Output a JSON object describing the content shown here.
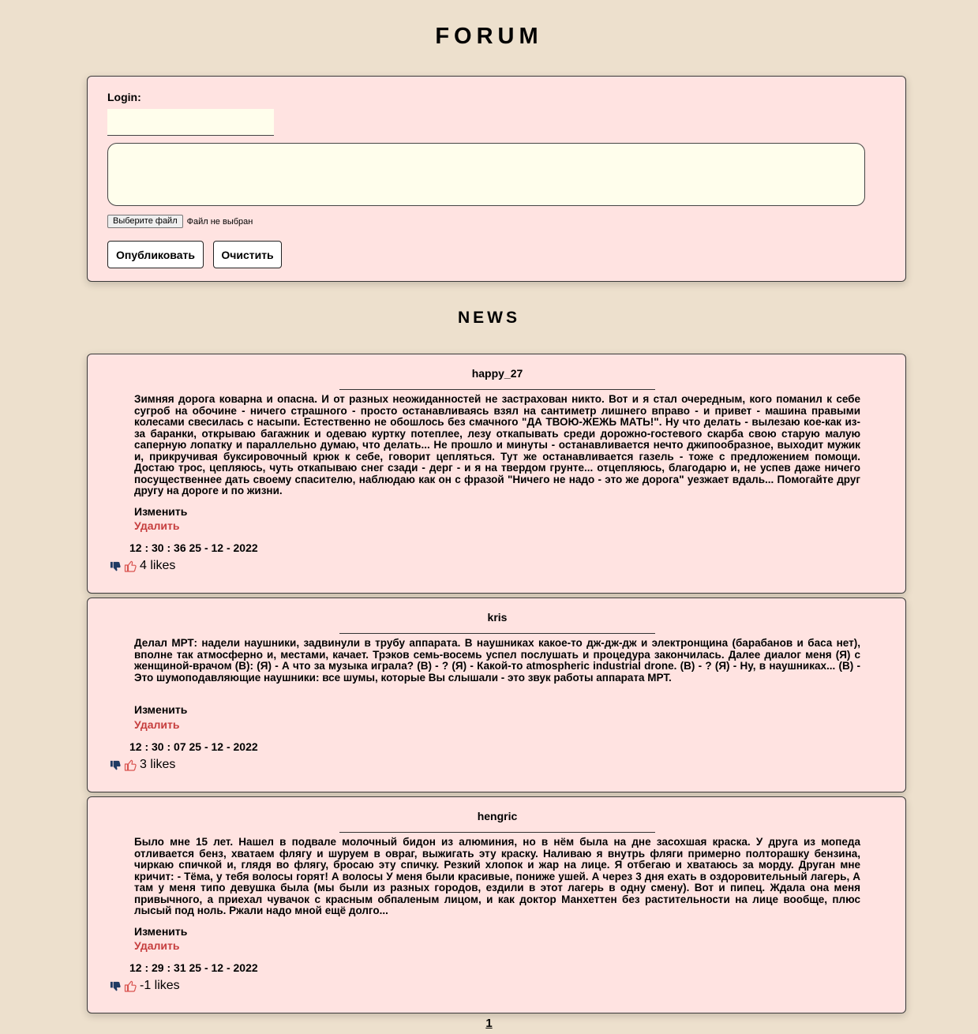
{
  "header": {
    "title": "FORUM"
  },
  "form": {
    "login_label": "Login:",
    "login_value": "",
    "message_value": "",
    "file_button_label": "Выберите файл",
    "file_status": "Файл не выбран",
    "publish_label": "Опубликовать",
    "clear_label": "Очистить"
  },
  "news": {
    "title": "NEWS",
    "edit_label": "Изменить",
    "delete_label": "Удалить",
    "posts": [
      {
        "author": "happy_27",
        "text": "Зимняя дорога коварна и опасна. И от разных неожиданностей не застрахован никто. Вот и я стал очередным, кого поманил к себе сугроб на обочине - ничего страшного - просто останавливаясь взял на сантиметр лишнего вправо - и привет - машина правыми колесами свесилась с насыпи. Естественно не обошлось без смачного \"ДА ТВОЮ-ЖЕЖЬ МАТЬ!\". Ну что делать - вылезаю кое-как из-за баранки, открываю багажник и одеваю куртку потеплее, лезу откапывать среди дорожно-гостевого скарба свою старую малую саперную лопатку и параллельно думаю, что делать... Не прошло и минуты - останавливается нечто джипообразное, выходит мужик и, прикручивая буксировочный крюк к себе, говорит цепляться. Тут же останавливается газель - тоже с предложением помощи. Достаю трос, цепляюсь, чуть откапываю снег сзади - дерг - и я на твердом грунте... отцепляюсь, благодарю и, не успев даже ничего посущественнее дать своему спасителю, наблюдаю как он с фразой \"Ничего не надо - это же дорога\" уезжает вдаль... Помогайте друг другу на дороге и по жизни.",
        "time": "12 : 30 : 36 25 - 12 - 2022",
        "likes": "4 likes"
      },
      {
        "author": "kris",
        "text": "Делал МРТ: надели наушники, задвинули в трубу аппарата. В наушниках какое-то дж-дж-дж и электронщина (барабанов и баса нет), вполне так атмосферно и, местами, качает. Трэков семь-восемь успел послушать и процедура закончилась. Далее диалог меня (Я) с женщиной-врачом (В): (Я) - А что за музыка играла? (В) - ? (Я) - Какой-то atmospheric industrial drone. (В) - ? (Я) - Ну, в наушниках... (В) - Это шумоподавляющие наушники: все шумы, которые Вы слышали - это звук работы аппарата МРТ.",
        "time": "12 : 30 : 07 25 - 12 - 2022",
        "likes": "3 likes"
      },
      {
        "author": "hengric",
        "text": "Было мне 15 лет. Нашел в подвале молочный бидон из алюминия, но в нём была на дне засохшая краска. У друга из мопеда отливается бенз, хватаем флягу и шуруем в овраг, выжигать эту краску. Наливаю я внутрь фляги примерно полторашку бензина, чиркаю спичкой и, глядя во флягу, бросаю эту спичку. Резкий хлопок и жар на лице. Я отбегаю и хватаюсь за морду. Друган мне кричит: - Тёма, у тебя волосы горят! А волосы У меня были красивые, пониже ушей. А через 3 дня ехать в оздоровительный лагерь, А там у меня типо девушка была (мы были из разных городов, ездили в этот лагерь в одну смену). Вот и пипец. Ждала она меня привычного, а приехал чувачок с красным обпаленым лицом, и как доктор Манхеттен без растительности на лице вообще, плюс лысый под ноль. Ржали надо мной ещё долго...",
        "time": "12 : 29 : 31 25 - 12 - 2022",
        "likes": "-1 likes"
      }
    ]
  },
  "pagination": {
    "current_page": "1"
  },
  "colors": {
    "page_background": "#ede0cd",
    "panel_background": "#ffe3e1",
    "input_background": "#fffeec",
    "delete_link": "#c63d3d",
    "dislike_icon": "#1f3a63",
    "like_icon": "#d9534f"
  }
}
